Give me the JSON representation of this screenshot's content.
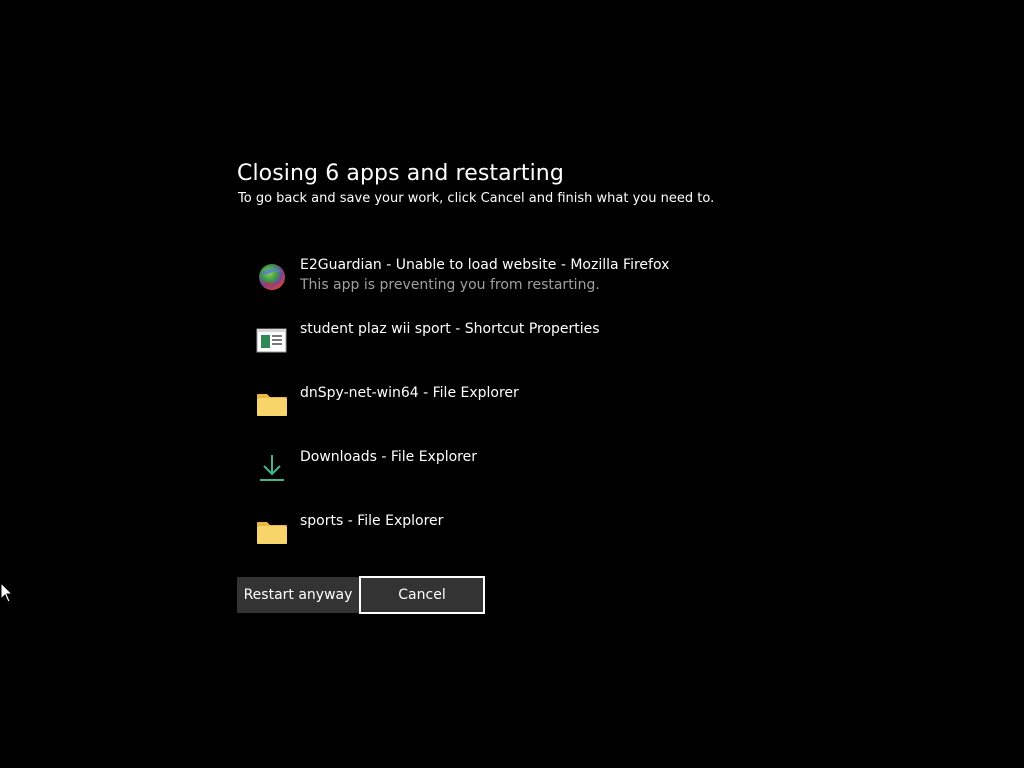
{
  "dialog": {
    "title": "Closing 6 apps and restarting",
    "subtitle": "To go back and save your work, click Cancel and finish what you need to."
  },
  "apps": [
    {
      "name": "E2Guardian - Unable to load website - Mozilla Firefox",
      "note": "This app is preventing you from restarting.",
      "icon": "firefox-globe-icon"
    },
    {
      "name": "student plaz wii sport - Shortcut Properties",
      "note": "",
      "icon": "properties-window-icon"
    },
    {
      "name": "dnSpy-net-win64 - File Explorer",
      "note": "",
      "icon": "folder-icon"
    },
    {
      "name": "Downloads - File Explorer",
      "note": "",
      "icon": "downloads-arrow-icon"
    },
    {
      "name": "sports - File Explorer",
      "note": "",
      "icon": "folder-icon"
    }
  ],
  "buttons": {
    "restart_label": "Restart anyway",
    "cancel_label": "Cancel"
  },
  "colors": {
    "background": "#000000",
    "button_bg": "#333333",
    "focus_border": "#ffffff",
    "secondary_text": "#a0a0a0",
    "folder_yellow": "#f8d56b",
    "download_green": "#3fb68b"
  }
}
